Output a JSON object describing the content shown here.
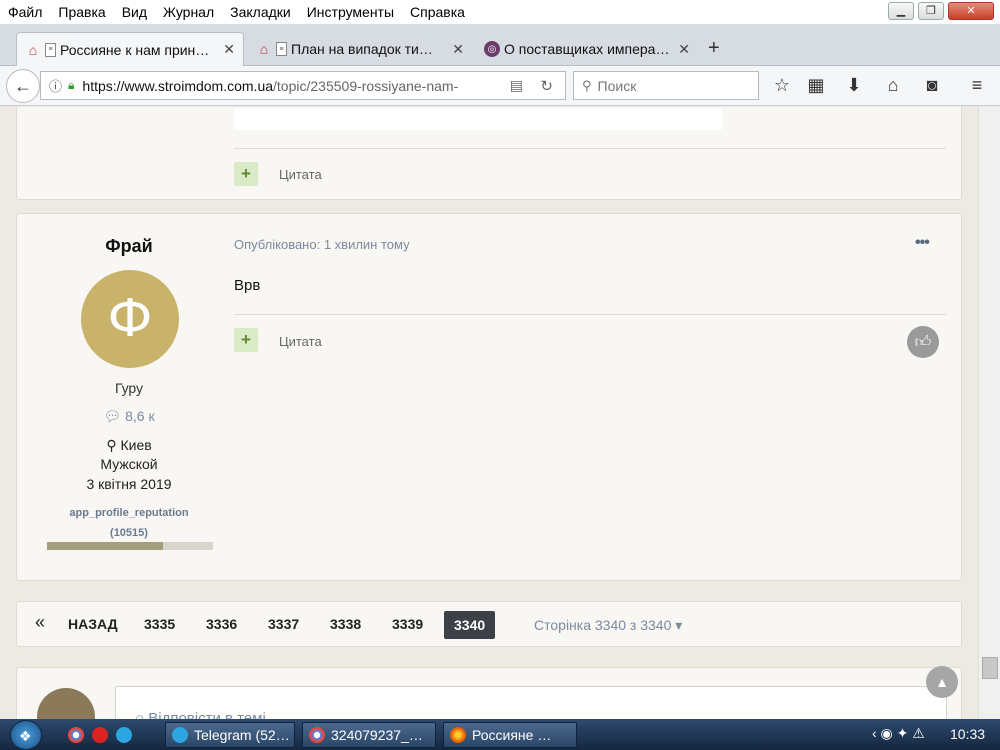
{
  "menu": [
    "Файл",
    "Правка",
    "Вид",
    "Журнал",
    "Закладки",
    "Инструменты",
    "Справка"
  ],
  "tabs": [
    {
      "title": "Россияне к нам прин…"
    },
    {
      "title": "План на випадок ти…"
    },
    {
      "title": "О поставщиках импера…"
    }
  ],
  "nav": {
    "url_domain": "https://www.stroimdom.com.ua",
    "url_path": "/topic/235509-rossiyane-nam-",
    "search_placeholder": "Поиск"
  },
  "prev_post": {
    "quote_label": "Цитата"
  },
  "post": {
    "author": "Фрай",
    "avatar_letter": "Ф",
    "rank": "Гуру",
    "posts_count": "8,6 к",
    "city": "Киев",
    "gender": "Мужской",
    "joined": "3 квітня 2019",
    "rep_label": "app_profile_reputation",
    "rep_value": "(10515)",
    "rep_fraction": 0.7,
    "published": "Опубліковано: 1 хвилин тому",
    "body": "Врв",
    "quote_label": "Цитата",
    "more_label": "•••"
  },
  "pagination": {
    "first": "«",
    "back": "НАЗАД",
    "pages": [
      "3335",
      "3336",
      "3337",
      "3338",
      "3339"
    ],
    "current": "3340",
    "page_of": "Сторінка 3340 з 3340"
  },
  "reply": {
    "label": "Відповісти в темі"
  },
  "taskbar": {
    "tasks": [
      "Telegram (52…",
      "324079237_…",
      "Россияне …"
    ],
    "clock": "10:33"
  }
}
